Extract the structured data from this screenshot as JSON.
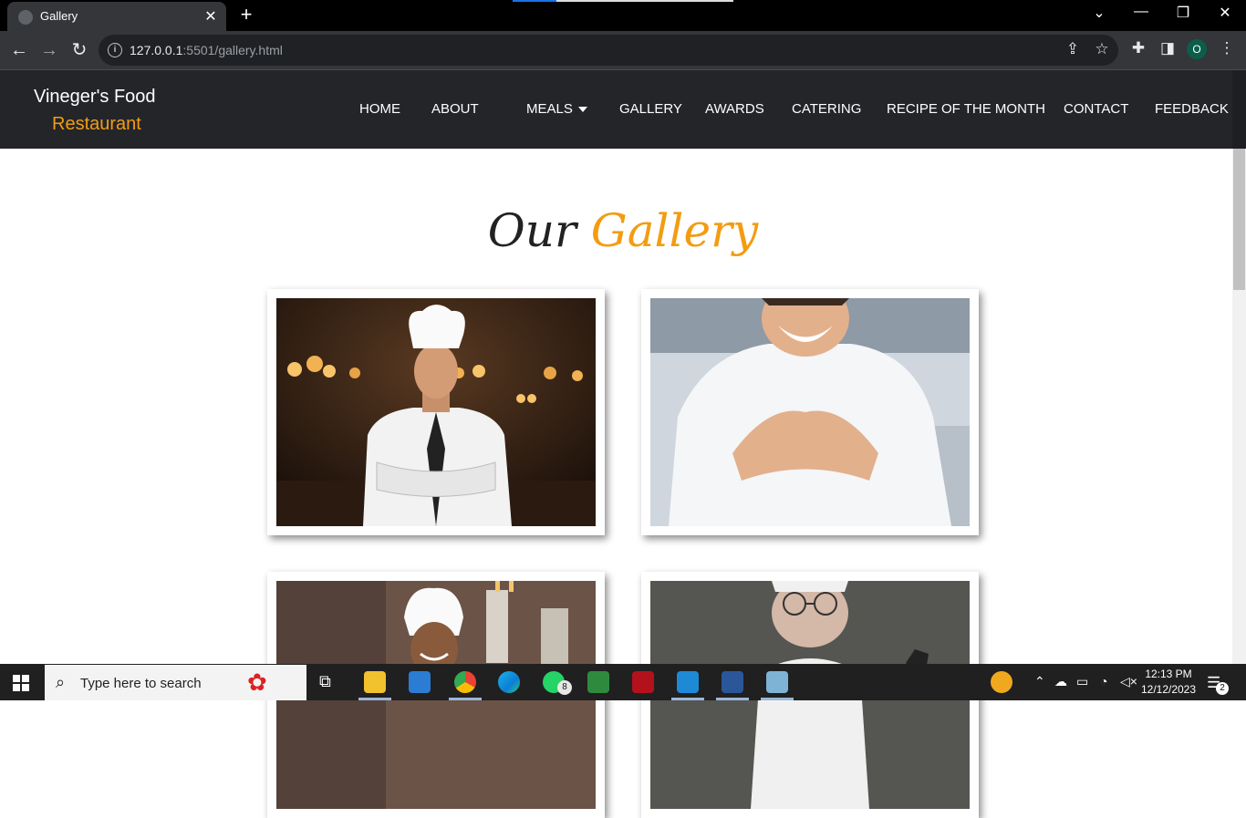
{
  "browser": {
    "tab_title": "Gallery",
    "new_tab": "+",
    "url_host": "127.0.0.1",
    "url_rest": ":5501/gallery.html",
    "profile_initial": "O"
  },
  "site": {
    "brand_line1": "Vineger's Food",
    "brand_line2": "Restaurant",
    "nav": [
      "HOME",
      "ABOUT",
      "MEALS",
      "GALLERY",
      "AWARDS",
      "CATERING",
      "RECIPE OF THE MONTH",
      "CONTACT",
      "FEEDBACK"
    ],
    "heading_word1": "Our",
    "heading_word2": "Gallery",
    "accent_color": "#f39c12",
    "nav_bg": "#232529"
  },
  "gallery": {
    "images": [
      {
        "alt": "chef with arms crossed in dark kitchen"
      },
      {
        "alt": "smiling chef resting chin on hands"
      },
      {
        "alt": "female chef in bakery"
      },
      {
        "alt": "older chef with glasses"
      }
    ]
  },
  "taskbar": {
    "search_placeholder": "Type here to search",
    "whatsapp_badge": "8",
    "time": "12:13 PM",
    "date": "12/12/2023",
    "notification_count": "2"
  }
}
